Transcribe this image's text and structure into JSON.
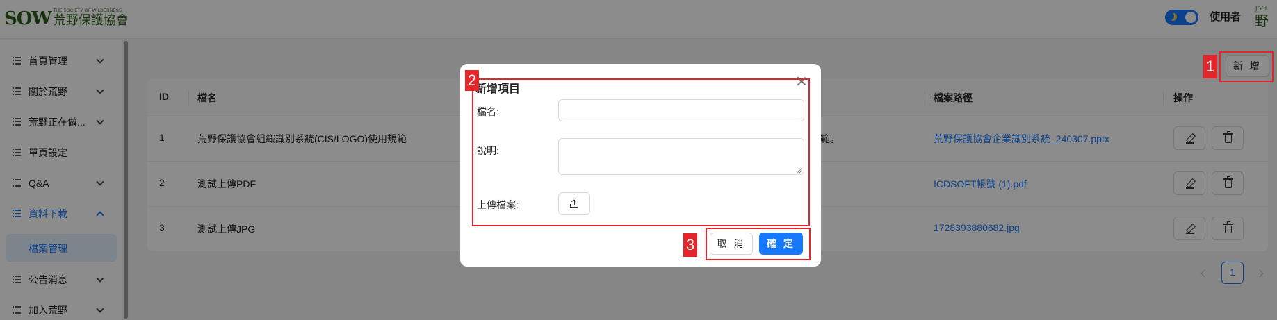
{
  "header": {
    "logo_mark": "SOW",
    "logo_subtitle": "THE SOCIETY OF WILDERNESS",
    "logo_name": "荒野保護協會",
    "user_name": "使用者",
    "mini_logo_top": "JOCL",
    "mini_logo_char": "野"
  },
  "sidebar": {
    "items": [
      {
        "label": "首頁管理"
      },
      {
        "label": "關於荒野"
      },
      {
        "label": "荒野正在做..."
      },
      {
        "label": "單頁設定"
      },
      {
        "label": "Q&A"
      },
      {
        "label": "資料下載"
      },
      {
        "label": "公告消息"
      },
      {
        "label": "加入荒野"
      }
    ],
    "active_sub_item": "檔案管理"
  },
  "toolbar": {
    "add_label": "新 增"
  },
  "table": {
    "columns": [
      "ID",
      "檔名",
      "",
      "檔案路徑",
      "操作"
    ],
    "rows": [
      {
        "id": "1",
        "name": "荒野保護協會組織識別系統(CIS/LOGO)使用規範",
        "desc_fragment": "範。",
        "path": "荒野保護協會企業識別系統_240307.pptx"
      },
      {
        "id": "2",
        "name": "測試上傳PDF",
        "desc_fragment": "",
        "path": "ICDSOFT帳號 (1).pdf"
      },
      {
        "id": "3",
        "name": "測試上傳JPG",
        "desc_fragment": "",
        "path": "1728393880682.jpg"
      }
    ]
  },
  "pagination": {
    "current_page": "1"
  },
  "modal": {
    "title": "新增項目",
    "name_label": "檔名:",
    "desc_label": "說明:",
    "upload_label": "上傳檔案:",
    "name_value": "",
    "desc_value": "",
    "cancel_label": "取 消",
    "ok_label": "確 定"
  },
  "annotations": [
    "1",
    "2",
    "3"
  ],
  "colors": {
    "primary": "#1677ff",
    "annotation_red": "#e4262a",
    "logo_green": "#2c5e1a"
  }
}
